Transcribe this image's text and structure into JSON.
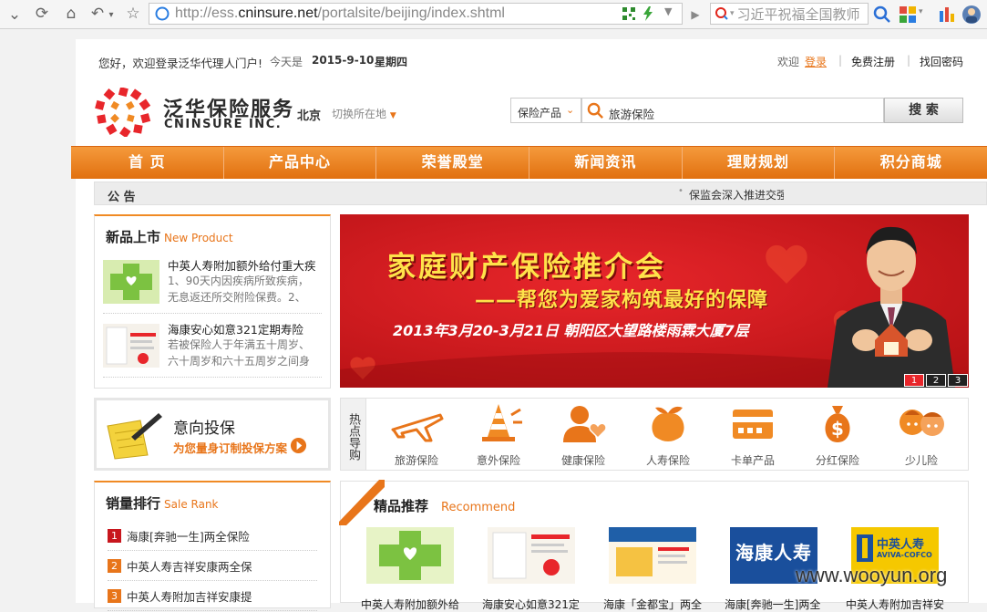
{
  "browser": {
    "url_prefix": "http://ess.",
    "url_domain": "cninsure.net",
    "url_path": "/portalsite/beijing/index.shtml",
    "search_text": "习近平祝福全国教师"
  },
  "topbar": {
    "greeting": "您好，欢迎登录泛华代理人门户!",
    "today_label": "今天是",
    "date": "2015-9-10",
    "weekday": "星期四",
    "welcome": "欢迎",
    "login": "登录",
    "register": "免费注册",
    "find_password": "找回密码"
  },
  "header": {
    "logo_cn": "泛华保险服务",
    "logo_en": "CNINSURE INC.",
    "city": "北京",
    "switch_city": "切换所在地",
    "search_category": "保险产品",
    "search_value": "旅游保险",
    "search_button": "搜 索"
  },
  "nav": [
    "首 页",
    "产品中心",
    "荣誉殿堂",
    "新闻资讯",
    "理财规划",
    "积分商城"
  ],
  "notice": {
    "label": "公 告",
    "text": "保监会深入推进交强"
  },
  "new_products": {
    "title": "新品上市",
    "subtitle": "New Product",
    "items": [
      {
        "name": "中英人寿附加额外给付重大疾",
        "desc": "1、90天内因疾病所致疾病，无息返还所交附险保费。2、"
      },
      {
        "name": "海康安心如意321定期寿险",
        "desc": "若被保险人于年满五十周岁、六十周岁和六十五周岁之间身"
      }
    ]
  },
  "intent": {
    "title": "意向投保",
    "subtitle": "为您量身订制投保方案"
  },
  "sales_rank": {
    "title": "销量排行",
    "subtitle": "Sale Rank",
    "items": [
      {
        "num": "1",
        "name": "海康[奔驰一生]两全保险"
      },
      {
        "num": "2",
        "name": "中英人寿吉祥安康两全保"
      },
      {
        "num": "3",
        "name": "中英人寿附加吉祥安康提"
      }
    ]
  },
  "banner": {
    "title": "家庭财产保险推介会",
    "subtitle": "——帮您为爱家构筑最好的保障",
    "detail": "2013年3月20-3月21日  朝阳区大望路楼雨霖大厦7层",
    "pages": [
      "1",
      "2",
      "3"
    ]
  },
  "hot": {
    "label": "热点导购",
    "items": [
      "旅游保险",
      "意外保险",
      "健康保险",
      "人寿保险",
      "卡单产品",
      "分红保险",
      "少儿险"
    ]
  },
  "recommend": {
    "title": "精品推荐",
    "subtitle": "Recommend",
    "items": [
      "中英人寿附加额外给",
      "海康安心如意321定",
      "海康「金都宝」两全",
      "海康[奔驰一生]两全",
      "中英人寿附加吉祥安"
    ]
  },
  "rec_logos": {
    "haikang": "海康人寿",
    "zhongying_cn": "中英人寿",
    "zhongying_en": "AVIVA-COFCO"
  },
  "watermark": "www.wooyun.org"
}
